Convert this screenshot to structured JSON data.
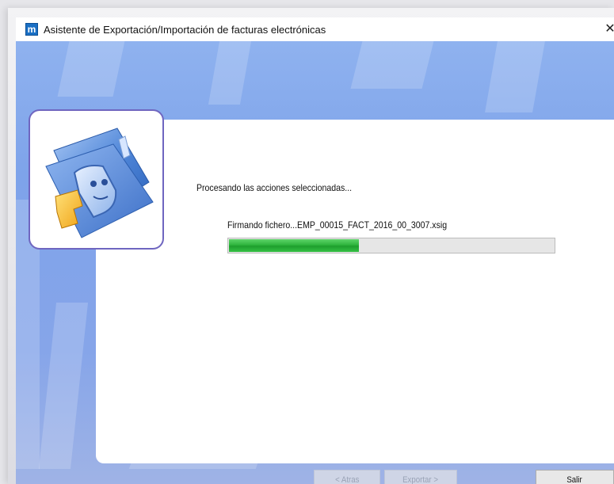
{
  "window": {
    "title": "Asistente de Exportación/Importación de facturas electrónicas",
    "app_icon_letter": "m",
    "close_glyph": "✕"
  },
  "content": {
    "processing_label": "Procesando las acciones seleccionadas...",
    "current_file_label": "Firmando fichero...EMP_00015_FACT_2016_00_3007.xsig",
    "progress": {
      "fraction": 0.4
    }
  },
  "buttons": {
    "back_label": "< Atras",
    "export_label": "Exportar >",
    "exit_label": "Salir"
  },
  "icons": {
    "logo": "wizard-folder-icon"
  },
  "colors": {
    "background_blue": "#86a5e9",
    "progress_green": "#2eb53d",
    "logo_border": "#6f66c0",
    "app_icon": "#1a6fc4"
  }
}
